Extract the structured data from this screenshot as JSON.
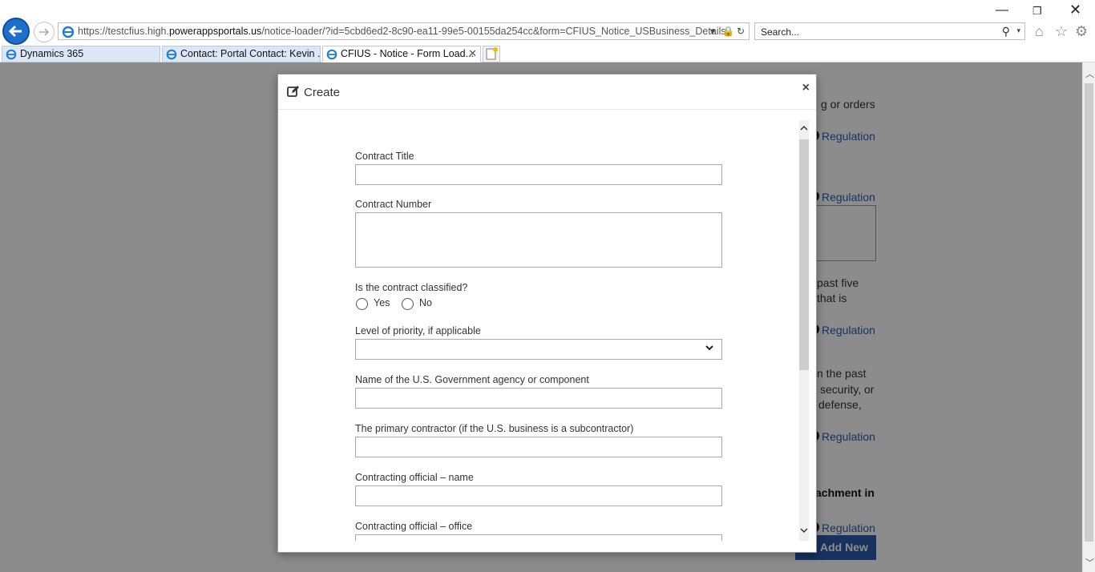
{
  "browser": {
    "url_prefix": "https://testcfius.high.",
    "url_domain": "powerappsportals.us",
    "url_path": "/notice-loader/?id=5cbd6ed2-8c90-ea11-99e5-00155da254cc&form=CFIUS_Notice_USBusiness_Details",
    "search_placeholder": "Search...",
    "tabs": [
      {
        "label": "Dynamics 365"
      },
      {
        "label": "Contact: Portal Contact: Kevin ..."
      },
      {
        "label": "CFIUS - Notice - Form Load..."
      }
    ]
  },
  "background": {
    "text_fragments": [
      "g or orders",
      "past five",
      "that is",
      "n the past",
      "security, or",
      "defense,"
    ],
    "regulation_link": "Regulation",
    "bold_fragment": "achment in",
    "add_new_button": "Add New"
  },
  "modal": {
    "title": "Create",
    "close_symbol": "×",
    "fields": {
      "contract_title": "Contract Title",
      "contract_number": "Contract Number",
      "classified": "Is the contract classified?",
      "yes": "Yes",
      "no": "No",
      "priority": "Level of priority, if applicable",
      "agency": "Name of the U.S. Government agency or component",
      "primary_contractor": "The primary contractor (if the U.S. business is a subcontractor)",
      "official_name": "Contracting official – name",
      "official_office": "Contracting official – office"
    }
  }
}
